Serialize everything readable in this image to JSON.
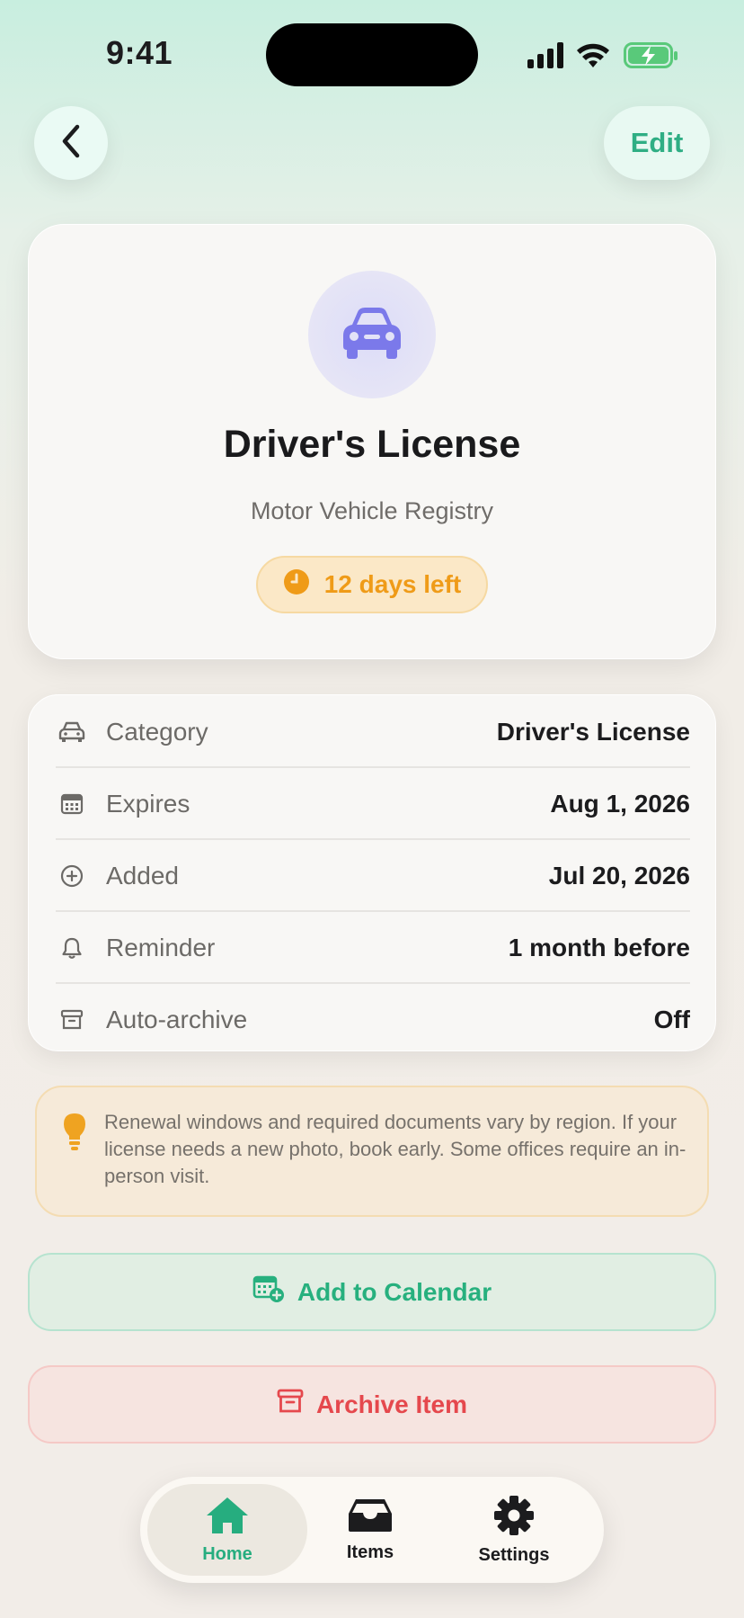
{
  "status_bar": {
    "time": "9:41"
  },
  "nav": {
    "edit_label": "Edit"
  },
  "hero": {
    "icon": "car-icon",
    "title": "Driver's License",
    "subtitle": "Motor Vehicle Registry",
    "badge": "12 days left"
  },
  "details": {
    "rows": [
      {
        "icon": "car-icon",
        "label": "Category",
        "value": "Driver's License"
      },
      {
        "icon": "calendar-icon",
        "label": "Expires",
        "value": "Aug 1, 2026"
      },
      {
        "icon": "plus-circle-icon",
        "label": "Added",
        "value": "Jul 20, 2026"
      },
      {
        "icon": "bell-icon",
        "label": "Reminder",
        "value": "1 month before"
      },
      {
        "icon": "archive-icon",
        "label": "Auto-archive",
        "value": "Off"
      }
    ]
  },
  "tip": {
    "icon": "lightbulb-icon",
    "text": "Renewal windows and required documents vary by region. If your license needs a new photo, book early. Some offices require an in-person visit."
  },
  "actions": {
    "calendar_label": "Add to Calendar",
    "archive_label": "Archive Item"
  },
  "tabbar": {
    "tabs": [
      {
        "label": "Home",
        "icon": "home-icon",
        "active": true
      },
      {
        "label": "Items",
        "icon": "inbox-icon",
        "active": false
      },
      {
        "label": "Settings",
        "icon": "gear-icon",
        "active": false
      }
    ]
  },
  "colors": {
    "accent": "#27b07e",
    "warning": "#ef9b18",
    "danger": "#e5484d",
    "hero_icon": "#7b79ea"
  }
}
